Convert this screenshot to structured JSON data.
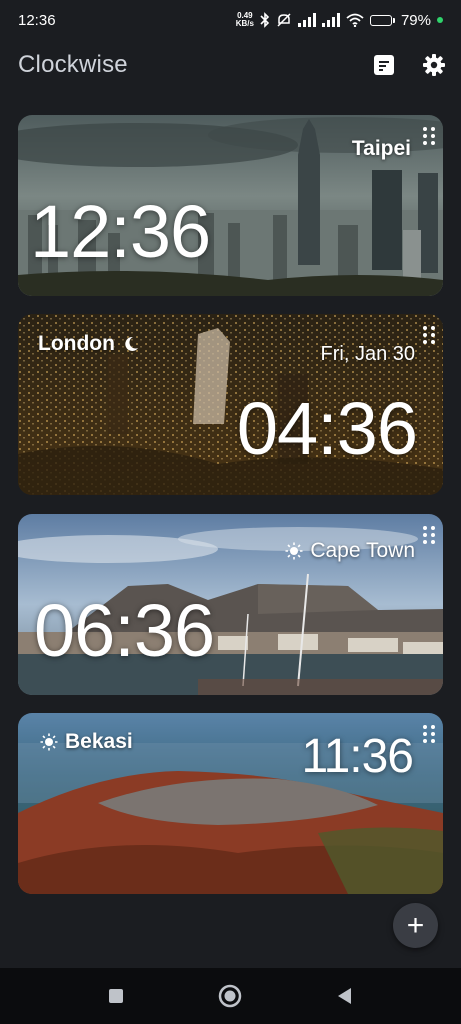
{
  "status_bar": {
    "time": "12:36",
    "net_speed_value": "0.49",
    "net_speed_unit": "KB/s",
    "battery_percent": "79",
    "battery_symbol": "%",
    "battery_level": 0.79
  },
  "app_bar": {
    "title": "Clockwise",
    "actions": [
      "notes-icon",
      "settings-icon"
    ]
  },
  "cards": [
    {
      "city": "Taipei",
      "time": "12:36",
      "date": "",
      "weather_icon": ""
    },
    {
      "city": "London",
      "time": "04:36",
      "date": "Fri, Jan 30",
      "weather_icon": "moon-icon"
    },
    {
      "city": "Cape Town",
      "time": "06:36",
      "date": "",
      "weather_icon": "sun-icon"
    },
    {
      "city": "Bekasi",
      "time": "11:36",
      "date": "",
      "weather_icon": "sun-icon"
    }
  ],
  "fab": {
    "label": "+"
  },
  "colors": {
    "background": "#1b1d21",
    "card_taipei": "#5b6668",
    "card_london": "#3a2a12",
    "card_capetown": "#6f8aa8",
    "card_bekasi": "#7a4a2e",
    "nav_bar": "#0b0c0e"
  }
}
